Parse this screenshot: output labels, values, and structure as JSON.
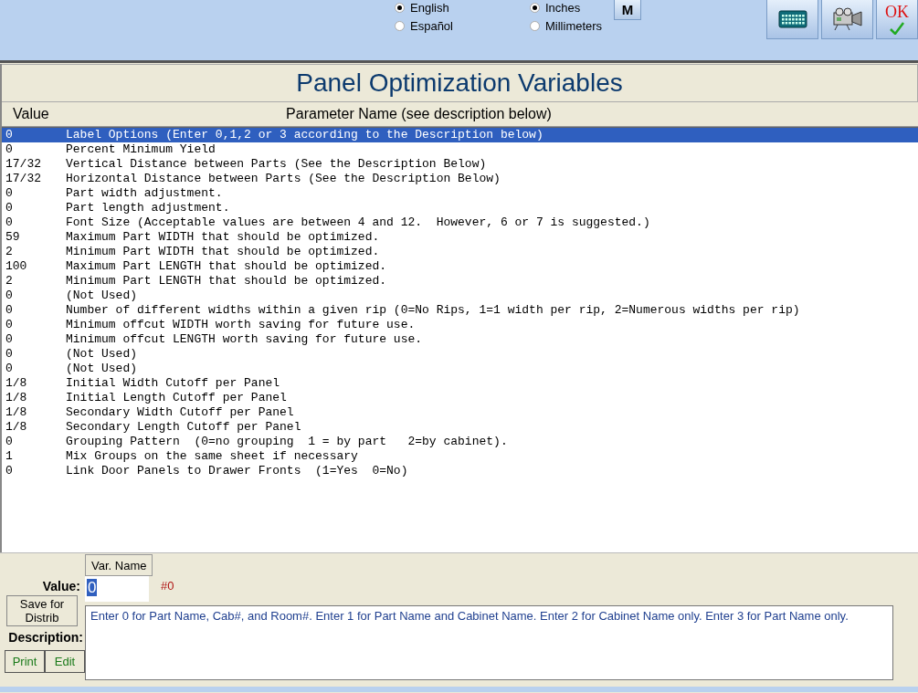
{
  "language_options": [
    {
      "label": "English",
      "selected": true
    },
    {
      "label": "Español",
      "selected": false
    }
  ],
  "unit_options": [
    {
      "label": "Inches",
      "selected": true
    },
    {
      "label": "Millimeters",
      "selected": false
    }
  ],
  "m_button": "M",
  "toolbar_buttons": [
    {
      "kind": "calculator"
    },
    {
      "kind": "camera"
    },
    {
      "kind": "ok",
      "label": "OK"
    }
  ],
  "title": "Panel Optimization Variables",
  "columns": [
    "Value",
    "Parameter Name (see description below)"
  ],
  "rows": [
    {
      "value": "0",
      "name": "Label Options (Enter 0,1,2 or 3 according to the Description below)",
      "selected": true
    },
    {
      "value": "0",
      "name": "Percent Minimum Yield",
      "selected": false
    },
    {
      "value": "17/32",
      "name": "Vertical Distance between Parts (See the Description Below)",
      "selected": false
    },
    {
      "value": "17/32",
      "name": "Horizontal Distance between Parts (See the Description Below)",
      "selected": false
    },
    {
      "value": "0",
      "name": "Part width adjustment.",
      "selected": false
    },
    {
      "value": "0",
      "name": "Part length adjustment.",
      "selected": false
    },
    {
      "value": "0",
      "name": "Font Size (Acceptable values are between 4 and 12.  However, 6 or 7 is suggested.)",
      "selected": false
    },
    {
      "value": "59",
      "name": "Maximum Part WIDTH that should be optimized.",
      "selected": false
    },
    {
      "value": "2",
      "name": "Minimum Part WIDTH that should be optimized.",
      "selected": false
    },
    {
      "value": "100",
      "name": "Maximum Part LENGTH that should be optimized.",
      "selected": false
    },
    {
      "value": "2",
      "name": "Minimum Part LENGTH that should be optimized.",
      "selected": false
    },
    {
      "value": "0",
      "name": "(Not Used)",
      "selected": false
    },
    {
      "value": "0",
      "name": "Number of different widths within a given rip (0=No Rips, 1=1 width per rip, 2=Numerous widths per rip)",
      "selected": false
    },
    {
      "value": "0",
      "name": "Minimum offcut WIDTH worth saving for future use.",
      "selected": false
    },
    {
      "value": "0",
      "name": "Minimum offcut LENGTH worth saving for future use.",
      "selected": false
    },
    {
      "value": "0",
      "name": "(Not Used)",
      "selected": false
    },
    {
      "value": "0",
      "name": "(Not Used)",
      "selected": false
    },
    {
      "value": "1/8",
      "name": "Initial Width Cutoff per Panel",
      "selected": false
    },
    {
      "value": "1/8",
      "name": "Initial Length Cutoff per Panel",
      "selected": false
    },
    {
      "value": "1/8",
      "name": "Secondary Width Cutoff per Panel",
      "selected": false
    },
    {
      "value": "1/8",
      "name": "Secondary Length Cutoff per Panel",
      "selected": false
    },
    {
      "value": "0",
      "name": "Grouping Pattern  (0=no grouping  1 = by part   2=by cabinet).",
      "selected": false
    },
    {
      "value": "1",
      "name": "Mix Groups on the same sheet if necessary",
      "selected": false
    },
    {
      "value": "0",
      "name": "Link Door Panels to Drawer Fronts  (1=Yes  0=No)",
      "selected": false
    }
  ],
  "editor": {
    "var_name_button": "Var. Name",
    "value_label": "Value:",
    "value": "0",
    "var_number": "#0",
    "save_button": "Save for Distrib",
    "description_label": "Description:",
    "print_button": "Print",
    "edit_button": "Edit",
    "description": "Enter 0 for Part Name, Cab#, and Room#.  Enter 1 for Part Name and Cabinet Name.  Enter 2 for Cabinet Name only.  Enter 3 for Part Name only."
  }
}
